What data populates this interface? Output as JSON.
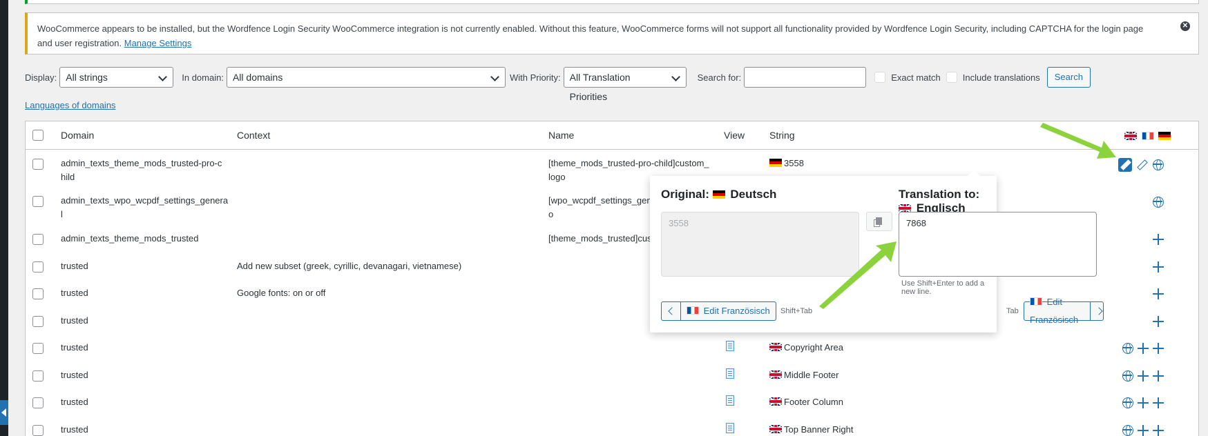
{
  "notice": {
    "text": "WooCommerce appears to be installed, but the Wordfence Login Security WooCommerce integration is not currently enabled. Without this feature, WooCommerce forms will not support all functionality provided by Wordfence Login Security, including CAPTCHA for the login page and user registration.",
    "link": "Manage Settings"
  },
  "filters": {
    "display_label": "Display:",
    "display_value": "All strings",
    "domain_label": "In domain:",
    "domain_value": "All domains",
    "priority_label": "With Priority:",
    "priority_value": "All Translation Priorities",
    "search_label": "Search for:",
    "search_value": "",
    "exact_match": "Exact match",
    "include_translations": "Include translations",
    "search_button": "Search"
  },
  "languages_link": "Languages of domains",
  "table": {
    "headers": {
      "domain": "Domain",
      "context": "Context",
      "name": "Name",
      "view": "View",
      "string": "String"
    },
    "rows": [
      {
        "domain": "admin_texts_theme_mods_trusted-pro-c",
        "domain2": "hild",
        "context": "",
        "name": "[theme_mods_trusted-pro-child]custom_",
        "name2": "logo",
        "string": "3558",
        "flag": "de"
      },
      {
        "domain": "admin_texts_wpo_wcpdf_settings_genera",
        "domain2": "l",
        "context": "",
        "name": "[wpo_wcpdf_settings_gene",
        "name2": "o",
        "string": "",
        "flag": ""
      },
      {
        "domain": "admin_texts_theme_mods_trusted",
        "domain2": "",
        "context": "",
        "name": "[theme_mods_trusted]cust",
        "name2": "",
        "string": "",
        "flag": ""
      },
      {
        "domain": "trusted",
        "context": "Add new subset (greek, cyrillic, devanagari, vietnamese)",
        "name": "",
        "string": "",
        "flag": ""
      },
      {
        "domain": "trusted",
        "context": "Google fonts: on or off",
        "name": "",
        "string": "",
        "flag": ""
      },
      {
        "domain": "trusted",
        "context": "",
        "name": "",
        "string": "",
        "flag": ""
      },
      {
        "domain": "trusted",
        "context": "",
        "name": "",
        "string": "Copyright Area",
        "flag": "gb"
      },
      {
        "domain": "trusted",
        "context": "",
        "name": "",
        "string": "Middle Footer",
        "flag": "gb"
      },
      {
        "domain": "trusted",
        "context": "",
        "name": "",
        "string": "Footer Column",
        "flag": "gb"
      },
      {
        "domain": "trusted",
        "context": "",
        "name": "",
        "string": "Top Banner Right",
        "flag": "gb"
      }
    ]
  },
  "popup": {
    "original_label": "Original:",
    "original_lang": "Deutsch",
    "translation_label": "Translation to:",
    "translation_lang": "Englisch",
    "original_value": "3558",
    "translation_value": "7868",
    "hint": "Use Shift+Enter to add a new line.",
    "prev_button": "Edit Französisch",
    "prev_shortcut": "Shift+Tab",
    "next_button": "Edit Französisch",
    "next_shortcut": "Tab"
  },
  "colors": {
    "accent": "#2271b1",
    "arrow": "#8cd23c",
    "notice_border": "#dba617"
  }
}
